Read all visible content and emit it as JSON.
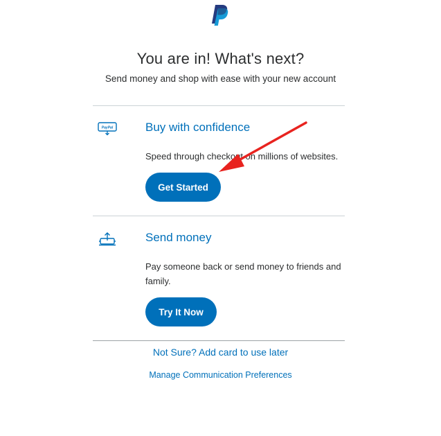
{
  "header": {
    "logo_icon": "paypal-logo-icon",
    "title": "You are in! What's next?",
    "subtitle": "Send money and shop with ease with your new account"
  },
  "sections": [
    {
      "icon": "paypal-card-icon",
      "title": "Buy with confidence",
      "text": "Speed through checkout on millions of websites.",
      "button_label": "Get Started"
    },
    {
      "icon": "send-money-icon",
      "title": "Send money",
      "text": "Pay someone back or send money to friends and family.",
      "button_label": "Try It Now"
    }
  ],
  "footer": {
    "add_card_link": "Not Sure? Add card to use later",
    "preferences_link": "Manage Communication Preferences"
  },
  "colors": {
    "accent": "#0070ba",
    "annotation_arrow": "#e8231f"
  }
}
